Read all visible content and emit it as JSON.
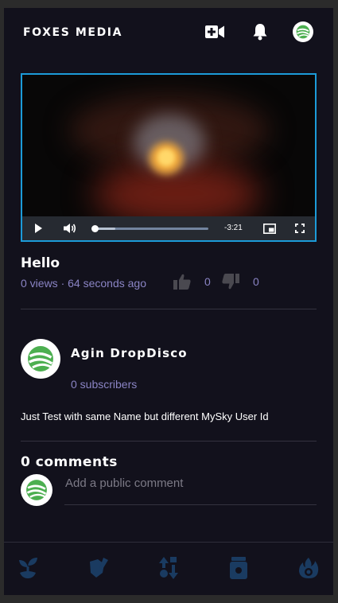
{
  "header": {
    "brand": "FOXES MEDIA",
    "upload_icon": "video-plus-icon",
    "notifications_icon": "bell-icon",
    "avatar_icon": "green-sphere-logo"
  },
  "player": {
    "time_remaining": "-3:21",
    "progress_fraction": 0.02,
    "buffered_fraction": 0.19,
    "controls": [
      "play-icon",
      "volume-icon",
      "picture-in-picture-icon",
      "fullscreen-icon"
    ]
  },
  "video": {
    "title": "Hello",
    "meta": "0 views · 64 seconds ago",
    "likes": "0",
    "dislikes": "0"
  },
  "channel": {
    "name": "Agin DropDisco",
    "subscribers": "0 subscribers",
    "description": "Just Test with same Name but different MySky User Id"
  },
  "comments": {
    "title": "0 comments",
    "placeholder": "Add a public comment"
  },
  "nav": {
    "items": [
      "sprout-icon",
      "sticker-icon",
      "sort-arrows-icon",
      "jar-icon",
      "flame-icon"
    ]
  },
  "colors": {
    "background": "#12111c",
    "accent_border": "#1c9bd8",
    "muted_text": "#8a84c4",
    "nav_icon": "#1a3b61",
    "logo_green": "#4caf50"
  }
}
